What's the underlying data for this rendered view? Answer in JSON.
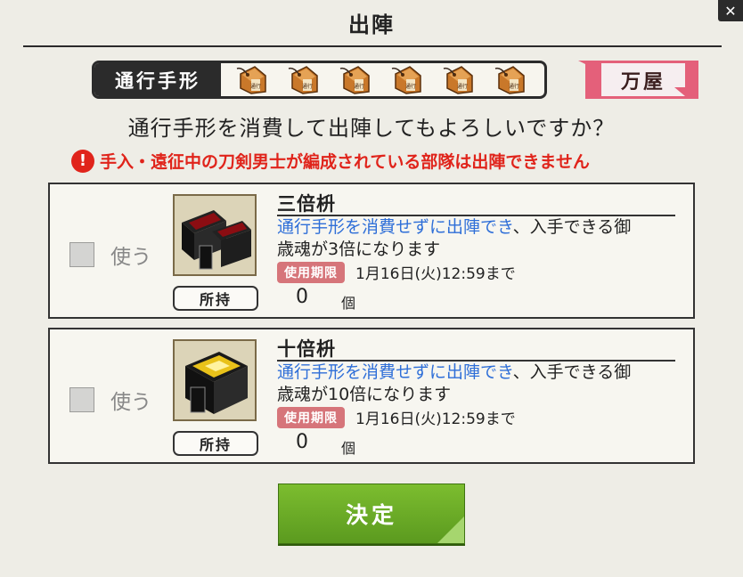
{
  "header": {
    "title": "出陣",
    "close": "✕"
  },
  "pass": {
    "label": "通行手形",
    "tag_text": "通行",
    "count": 6,
    "icon": "wooden-pass-tag-icon"
  },
  "shop": {
    "label": "万屋"
  },
  "prompt": "通行手形を消費して出陣してもよろしいですか？",
  "warning": {
    "icon": "!",
    "text": "手入・遠征中の刀剣男士が編成されている部隊は出陣できません"
  },
  "items": [
    {
      "use_label": "使う",
      "checked": false,
      "name": "三倍枡",
      "desc_highlight": "通行手形を消費せずに出陣でき",
      "desc_line1_rest": "、入手できる御",
      "desc_line2": "歳魂が3倍になります",
      "expiry_label": "使用期限",
      "expiry_date": "1月16日(火)12:59まで",
      "owned_label": "所持",
      "count": "0",
      "unit": "個",
      "icon": "red-masu-box-icon",
      "accent": "#8b0d12"
    },
    {
      "use_label": "使う",
      "checked": false,
      "name": "十倍枡",
      "desc_highlight": "通行手形を消費せずに出陣でき",
      "desc_line1_rest": "、入手できる御",
      "desc_line2": "歳魂が10倍になります",
      "expiry_label": "使用期限",
      "expiry_date": "1月16日(火)12:59まで",
      "owned_label": "所持",
      "count": "0",
      "unit": "個",
      "icon": "gold-masu-box-icon",
      "accent": "#e9c21a"
    }
  ],
  "confirm": {
    "label": "決定"
  }
}
